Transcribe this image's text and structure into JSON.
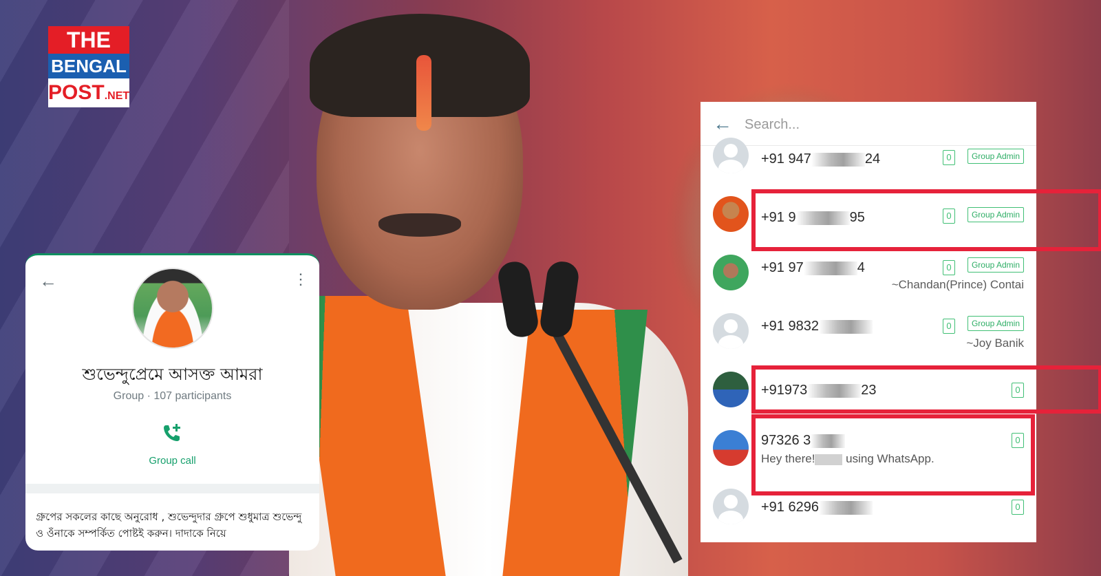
{
  "logo": {
    "line1": "THE",
    "line2": "BENGAL",
    "line3": "POST",
    "line3_suffix": ".NET"
  },
  "group_info": {
    "title": "শুভেন্দুপ্রেমে আসক্ত আমরা",
    "subtitle": "Group · 107 participants",
    "call_label": "Group call",
    "description": "গ্রুপের সকলের কাছে অনুরোধ , শুভেন্দুদার গ্রুপে শুধুমাত্র শুভেন্দু ও ওঁনাকে সম্পর্কিত পোষ্টই করুন। দাদাকে নিয়ে"
  },
  "participants": {
    "search_placeholder": "Search...",
    "admin_label": "Group Admin",
    "count_label": "0",
    "rows": [
      {
        "num_start": "+91 947",
        "num_end": "24",
        "admin": true,
        "name": ""
      },
      {
        "num_start": "+91 9",
        "num_end": "95",
        "admin": true,
        "name": ""
      },
      {
        "num_start": "+91 97",
        "num_end": "4",
        "admin": true,
        "name": "~Chandan(Prince) Contai"
      },
      {
        "num_start": "+91 9832",
        "num_end": "",
        "admin": true,
        "name": "~Joy Banik"
      },
      {
        "num_start": "+91973",
        "num_end": "23",
        "admin": false,
        "name": ""
      },
      {
        "num_start": "97326 3",
        "num_end": "",
        "admin": false,
        "name": "",
        "status_start": "Hey there!",
        "status_end": "using WhatsApp."
      },
      {
        "num_start": "+91 6296",
        "num_end": "",
        "admin": false,
        "name": ""
      }
    ]
  },
  "colors": {
    "whatsapp_green": "#16a06c",
    "highlight_red": "#e6223a",
    "logo_red": "#e41e26",
    "logo_blue": "#1b5fb0"
  },
  "icons": {
    "back": "arrow-left-icon",
    "menu": "more-vert-icon",
    "call": "add-call-icon"
  }
}
